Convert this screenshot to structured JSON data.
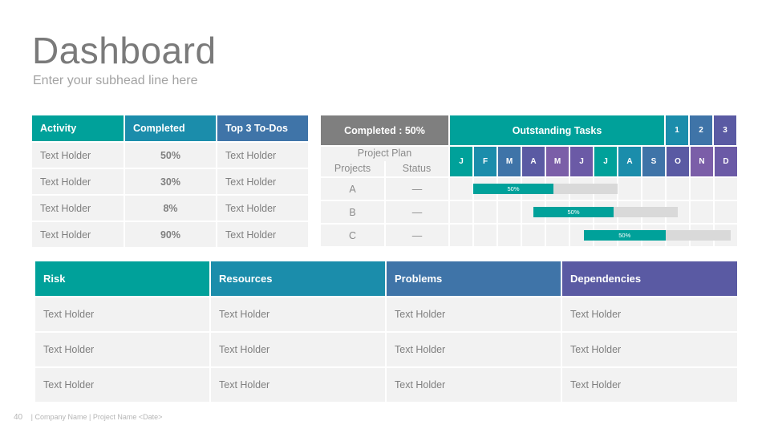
{
  "header": {
    "title": "Dashboard",
    "subtitle": "Enter your subhead line here"
  },
  "colors": {
    "teal": "#00a19a",
    "teal_blue": "#1b8dab",
    "steel_blue": "#3f74a8",
    "indigo": "#5a5aa3",
    "violet": "#7b5ea8",
    "grey_header": "#7f7f7f",
    "cell_bg": "#f2f2f2",
    "bar_bg": "#d9d9d9"
  },
  "activity_table": {
    "headers": [
      "Activity",
      "Completed",
      "Top 3 To-Dos"
    ],
    "rows": [
      [
        "Text Holder",
        "50%",
        "Text Holder"
      ],
      [
        "Text Holder",
        "30%",
        "Text Holder"
      ],
      [
        "Text Holder",
        "8%",
        "Text Holder"
      ],
      [
        "Text Holder",
        "90%",
        "Text Holder"
      ]
    ]
  },
  "gantt": {
    "completed_label": "Completed : 50%",
    "outstanding_label": "Outstanding Tasks",
    "quarters": [
      "1",
      "2",
      "3"
    ],
    "project_plan_label": "Project Plan",
    "projects_label": "Projects",
    "status_label": "Status",
    "months": [
      "J",
      "F",
      "M",
      "A",
      "M",
      "J",
      "J",
      "A",
      "S",
      "O",
      "N",
      "D"
    ],
    "rows": [
      {
        "project": "A",
        "status": "—",
        "start_month": 1.0,
        "end_month": 7.0,
        "progress": 50,
        "progress_label": "50%"
      },
      {
        "project": "B",
        "status": "—",
        "start_month": 3.5,
        "end_month": 9.5,
        "progress": 50,
        "progress_label": "50%"
      },
      {
        "project": "C",
        "status": "—",
        "start_month": 5.6,
        "end_month": 11.7,
        "progress": 50,
        "progress_label": "50%"
      }
    ]
  },
  "risk_table": {
    "headers": [
      "Risk",
      "Resources",
      "Problems",
      "Dependencies"
    ],
    "rows": [
      [
        "Text Holder",
        "Text Holder",
        "Text Holder",
        "Text Holder"
      ],
      [
        "Text Holder",
        "Text Holder",
        "Text Holder",
        "Text Holder"
      ],
      [
        "Text Holder",
        "Text Holder",
        "Text Holder",
        "Text Holder"
      ]
    ]
  },
  "footer": {
    "page_number": "40",
    "text": "| Company Name | Project Name <Date>"
  }
}
